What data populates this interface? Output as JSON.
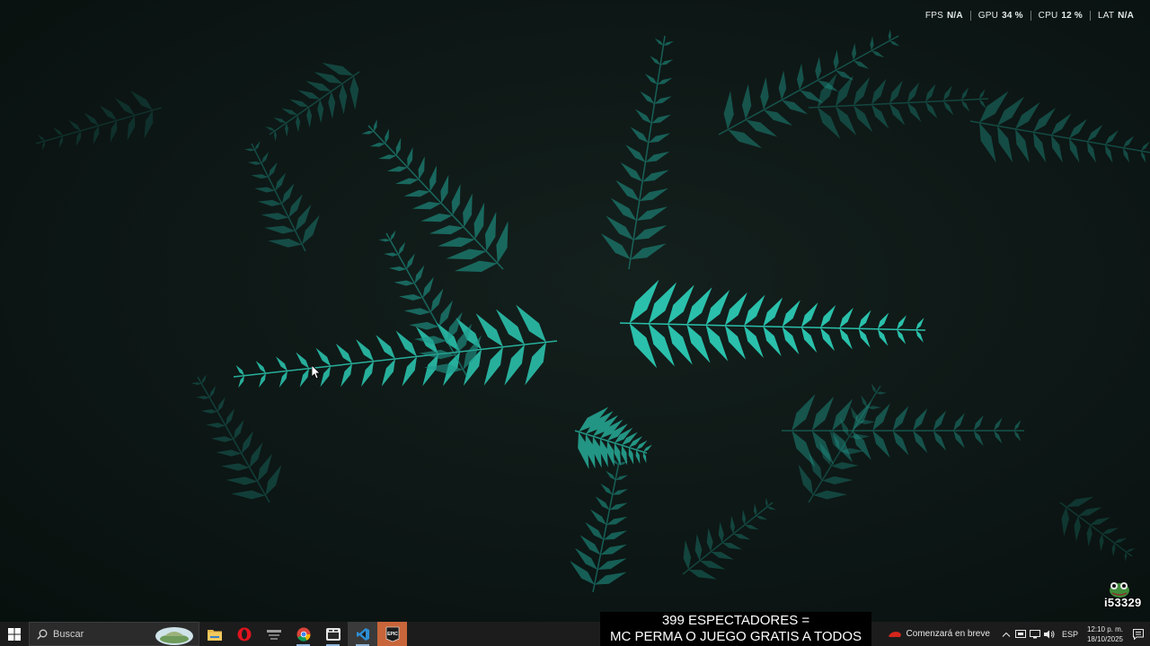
{
  "overlay": {
    "fps_label": "FPS",
    "fps_value": "N/A",
    "gpu_label": "GPU",
    "gpu_value": "34 %",
    "cpu_label": "CPU",
    "cpu_value": "12 %",
    "lat_label": "LAT",
    "lat_value": "N/A"
  },
  "mascot": {
    "label": "i53329"
  },
  "taskbar": {
    "search_placeholder": "Buscar",
    "apps": [
      {
        "name": "file-explorer",
        "icon": "folder-icon"
      },
      {
        "name": "opera",
        "icon": "opera-icon"
      },
      {
        "name": "game-launcher",
        "icon": "launcher-icon"
      },
      {
        "name": "chrome",
        "icon": "chrome-icon"
      },
      {
        "name": "media-app",
        "icon": "media-icon"
      },
      {
        "name": "vscode",
        "icon": "vscode-icon"
      },
      {
        "name": "epic-games",
        "icon": "epic-icon",
        "label": "EPIC"
      }
    ]
  },
  "banner": {
    "line1": "399 ESPECTADORES =",
    "line2": "MC PERMA O JUEGO GRATIS A TODOS"
  },
  "tray": {
    "weather_text": "Comenzará en breve",
    "language": "ESP",
    "time": "12:10 p. m.",
    "date": "18/10/2025"
  },
  "colors": {
    "fern": "#1f9a8c",
    "fern_bright": "#2cc9b3",
    "taskbar": "#1c1c1c",
    "epic": "#c8653a"
  }
}
